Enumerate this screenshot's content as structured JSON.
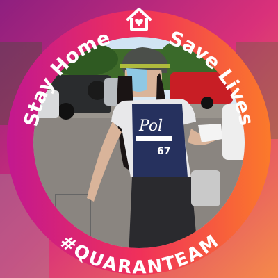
{
  "frame": {
    "top_left_text": "Stay Home",
    "top_right_text": "Save Lives",
    "bottom_text": "#QUARANTEAM",
    "icon": "house-heart-icon",
    "colors": {
      "ring_start": "#c2188f",
      "ring_mid": "#f0305a",
      "ring_end": "#fb7a2a",
      "bg_left": "#a01d7a",
      "bg_right": "#f27a3c"
    }
  }
}
